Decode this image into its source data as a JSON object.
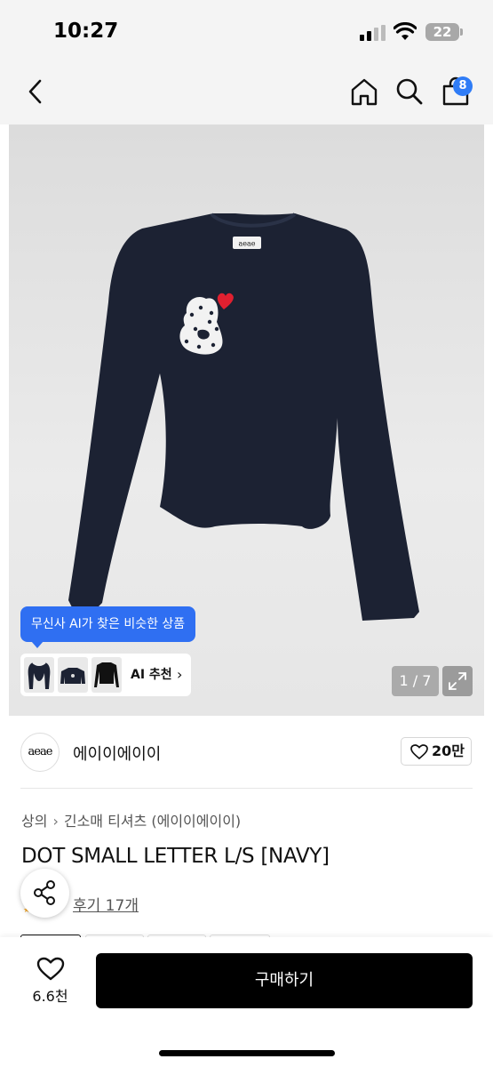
{
  "status_bar": {
    "time": "10:27",
    "battery": "22"
  },
  "nav": {
    "cart_count": "8"
  },
  "gallery": {
    "ai_tooltip": "무신사 AI가 찾은 비슷한 상품",
    "ai_label": "AI 추천",
    "counter": "1 / 7",
    "shirt_brand_tag": "aeae"
  },
  "brand": {
    "logo_text": "aeae",
    "name": "에이이에이이",
    "likes": "20만"
  },
  "breadcrumb": {
    "category": "상의",
    "subcategory": "긴소매 티셔츠",
    "brand": "(에이이에이이)"
  },
  "product": {
    "title": "DOT SMALL LETTER L/S [NAVY]",
    "reviews": "후기 17개"
  },
  "bottom": {
    "wish_count": "6.6천",
    "buy_label": "구매하기"
  },
  "colors": {
    "accent": "#2f6ff2",
    "shirt": "#1c2233",
    "heart": "#e02030"
  }
}
